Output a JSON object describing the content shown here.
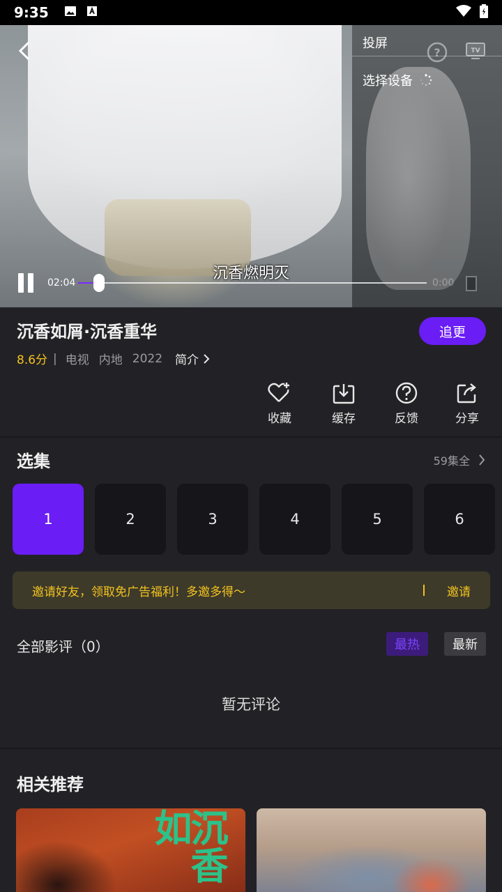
{
  "status_bar": {
    "time": "9:35"
  },
  "player": {
    "cast_title": "投屏",
    "cast_device_label": "选择设备",
    "subtitle": "沉香燃明灭",
    "current_time": "02:04",
    "total_time": "0:00",
    "progress": 0.06
  },
  "show": {
    "title": "沉香如屑·沉香重华",
    "follow_label": "追更",
    "score": "8.6分",
    "separator": "|",
    "type": "电视",
    "region": "内地",
    "year": "2022",
    "intro_label": "简介"
  },
  "actions": [
    {
      "label": "收藏",
      "icon": "heart-plus-icon"
    },
    {
      "label": "缓存",
      "icon": "download-icon"
    },
    {
      "label": "反馈",
      "icon": "question-icon"
    },
    {
      "label": "分享",
      "icon": "share-icon"
    }
  ],
  "episodes": {
    "title": "选集",
    "count_label": "59集全",
    "items": [
      "1",
      "2",
      "3",
      "4",
      "5",
      "6"
    ],
    "active": "1"
  },
  "invite": {
    "text": "邀请好友，领取免广告福利！多邀多得～",
    "button": "邀请"
  },
  "reviews": {
    "title": "全部影评（0）",
    "sort_hot": "最热",
    "sort_new": "最新",
    "empty": "暂无评论"
  },
  "recommend": {
    "title": "相关推荐",
    "poster_text": "沉香如"
  },
  "colors": {
    "accent": "#6a1df5",
    "score": "#f4c21f",
    "background": "#222226"
  }
}
